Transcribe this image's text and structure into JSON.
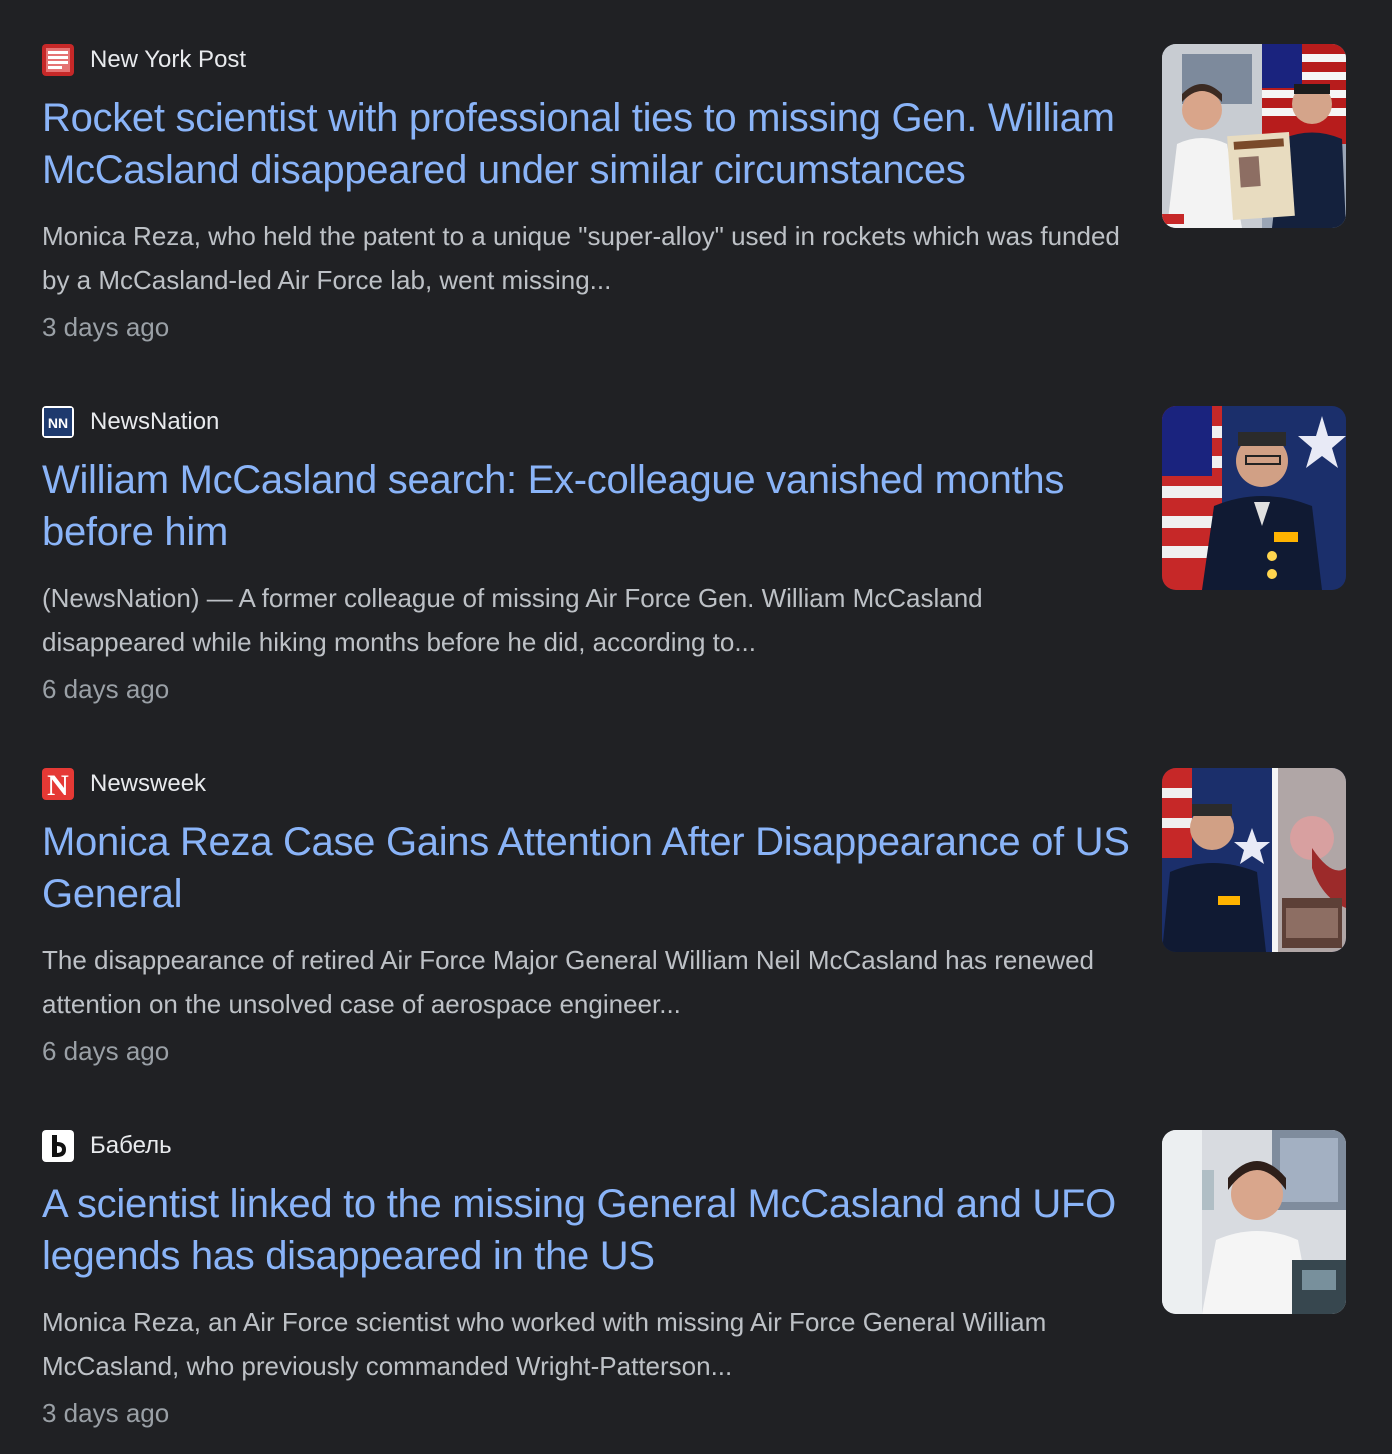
{
  "articles": [
    {
      "source": "New York Post",
      "favicon_icon": "new-york-post-logo-icon",
      "favicon_color": "#d32f2f",
      "title": "Rocket scientist with professional ties to missing Gen. William McCasland disappeared under similar circumstances",
      "snippet": "Monica Reza, who held the patent to a unique \"super-alloy\" used in rockets which was funded by a McCasland-led Air Force lab, went missing...",
      "time": "3 days ago",
      "thumbnail_icon": "scientist-and-general-photo"
    },
    {
      "source": "NewsNation",
      "favicon_icon": "newsnation-logo-icon",
      "favicon_color": "#1e3a6e",
      "title": "William McCasland search: Ex-colleague vanished months before him",
      "snippet": "(NewsNation) — A former colleague of missing Air Force Gen. William McCasland disappeared while hiking months before he did, according to...",
      "time": "6 days ago",
      "thumbnail_icon": "general-portrait-photo"
    },
    {
      "source": "Newsweek",
      "favicon_icon": "newsweek-logo-icon",
      "favicon_color": "#e53935",
      "favicon_letter": "N",
      "title": "Monica Reza Case Gains Attention After Disappearance of US General",
      "snippet": "The disappearance of retired Air Force Major General William Neil McCasland has renewed attention on the unsolved case of aerospace engineer...",
      "time": "6 days ago",
      "thumbnail_icon": "general-and-scientist-photo"
    },
    {
      "source": "Бабель",
      "favicon_icon": "babel-logo-icon",
      "favicon_color": "#ffffff",
      "title": "A scientist linked to the missing General McCasland and UFO legends has disappeared in the US",
      "snippet": "Monica Reza, an Air Force scientist who worked with missing Air Force General William McCasland, who previously commanded Wright-Patterson...",
      "time": "3 days ago",
      "thumbnail_icon": "scientist-lab-photo"
    }
  ]
}
